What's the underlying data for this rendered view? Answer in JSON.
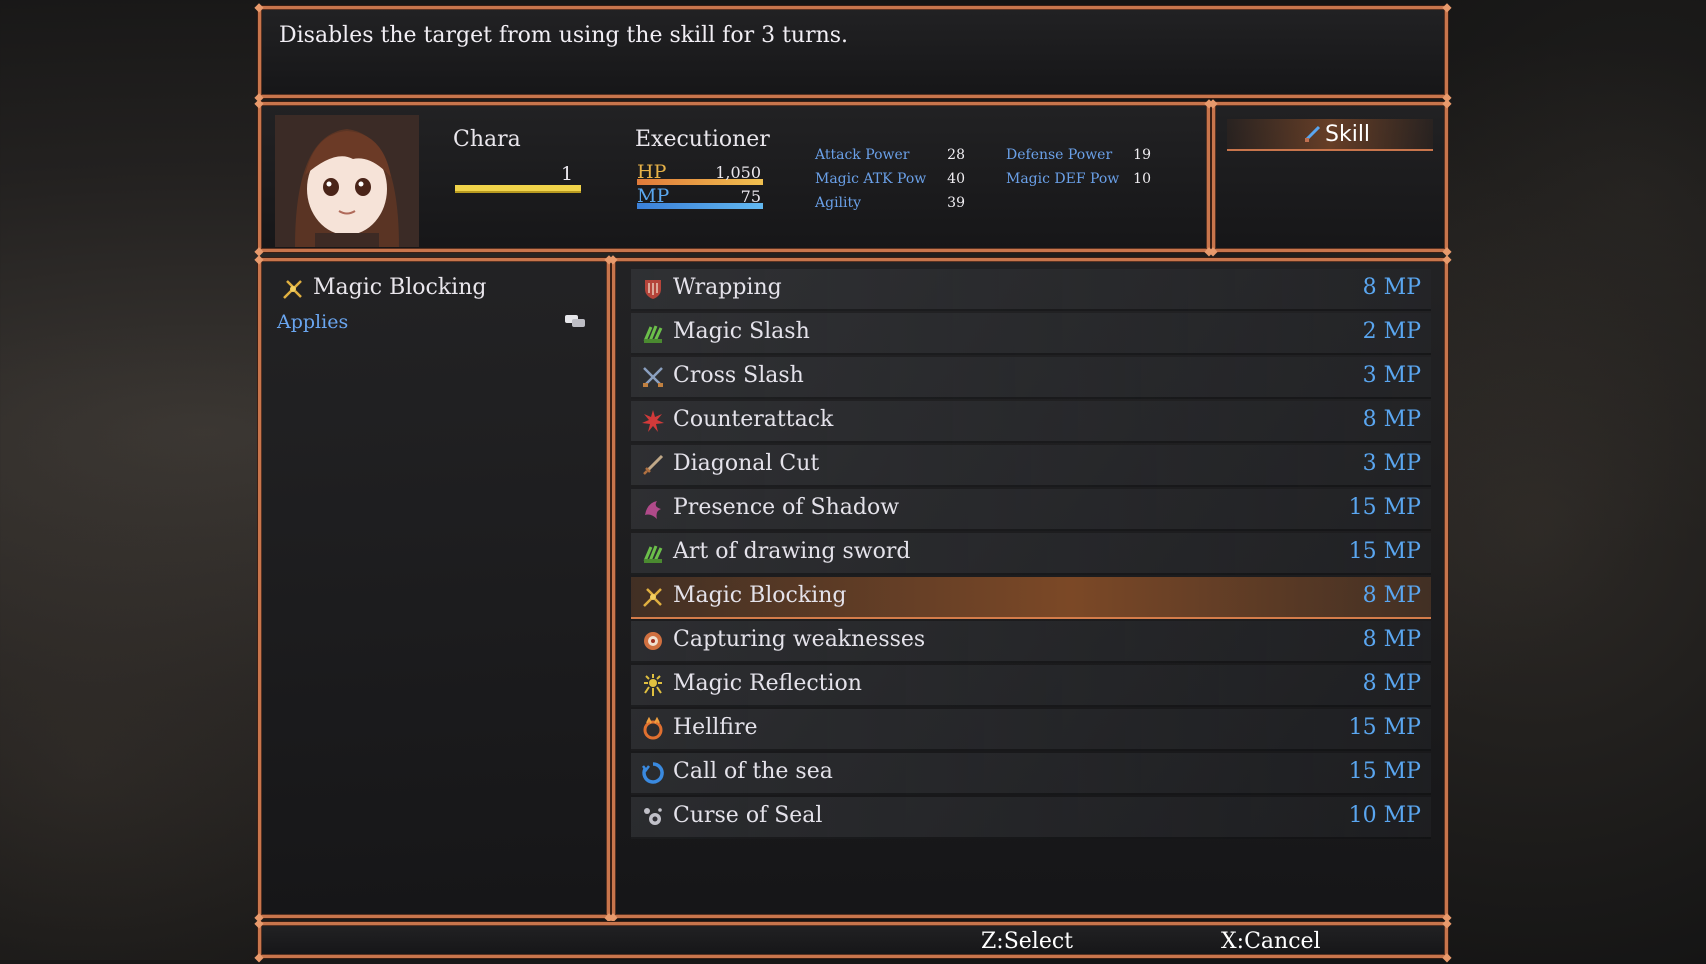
{
  "help": {
    "text": "Disables the target from using the skill for 3 turns."
  },
  "actor": {
    "name": "Chara",
    "level": "1",
    "class": "Executioner",
    "hp_label": "HP",
    "hp_value": "1,050",
    "mp_label": "MP",
    "mp_value": "75",
    "params": [
      {
        "label": "Attack Power",
        "value": "28"
      },
      {
        "label": "Magic ATK Pow",
        "value": "40"
      },
      {
        "label": "Agility",
        "value": "39"
      },
      {
        "label": "Defense Power",
        "value": "19"
      },
      {
        "label": "Magic DEF Pow",
        "value": "10"
      }
    ]
  },
  "command": {
    "label": "Skill",
    "icon": "sword-icon"
  },
  "selected_skill": {
    "name": "Magic Blocking",
    "applies_label": "Applies",
    "icon": "magic-blocking-icon"
  },
  "skills": [
    {
      "name": "Wrapping",
      "cost": "8 MP",
      "icon": "shield-icon",
      "color": "#b5443a"
    },
    {
      "name": "Magic Slash",
      "cost": "2 MP",
      "icon": "claw-icon",
      "color": "#6bbf4a"
    },
    {
      "name": "Cross Slash",
      "cost": "3 MP",
      "icon": "crossed-swords-icon",
      "color": "#8aa0c0"
    },
    {
      "name": "Counterattack",
      "cost": "8 MP",
      "icon": "burst-icon",
      "color": "#d23a3a"
    },
    {
      "name": "Diagonal Cut",
      "cost": "3 MP",
      "icon": "sword-icon",
      "color": "#c0a888"
    },
    {
      "name": "Presence of Shadow",
      "cost": "15 MP",
      "icon": "shadow-icon",
      "color": "#b04a8a"
    },
    {
      "name": "Art of drawing sword",
      "cost": "15 MP",
      "icon": "claw-icon",
      "color": "#6bbf4a"
    },
    {
      "name": "Magic Blocking",
      "cost": "8 MP",
      "icon": "magic-blocking-icon",
      "color": "#e0b040",
      "selected": true
    },
    {
      "name": "Capturing weaknesses",
      "cost": "8 MP",
      "icon": "target-icon",
      "color": "#d07040"
    },
    {
      "name": "Magic Reflection",
      "cost": "8 MP",
      "icon": "sunburst-icon",
      "color": "#e0c040"
    },
    {
      "name": "Hellfire",
      "cost": "15 MP",
      "icon": "fire-ring-icon",
      "color": "#e07030"
    },
    {
      "name": "Call of the sea",
      "cost": "15 MP",
      "icon": "wave-icon",
      "color": "#3a8ae0"
    },
    {
      "name": "Curse of Seal",
      "cost": "10 MP",
      "icon": "seal-icon",
      "color": "#c0c0c8"
    }
  ],
  "controls": {
    "select": "Z:Select",
    "cancel": "X:Cancel"
  },
  "colors": {
    "frame": "#c8754c",
    "mp_text": "#5aa6f0",
    "param_label": "#6aa0e8"
  }
}
